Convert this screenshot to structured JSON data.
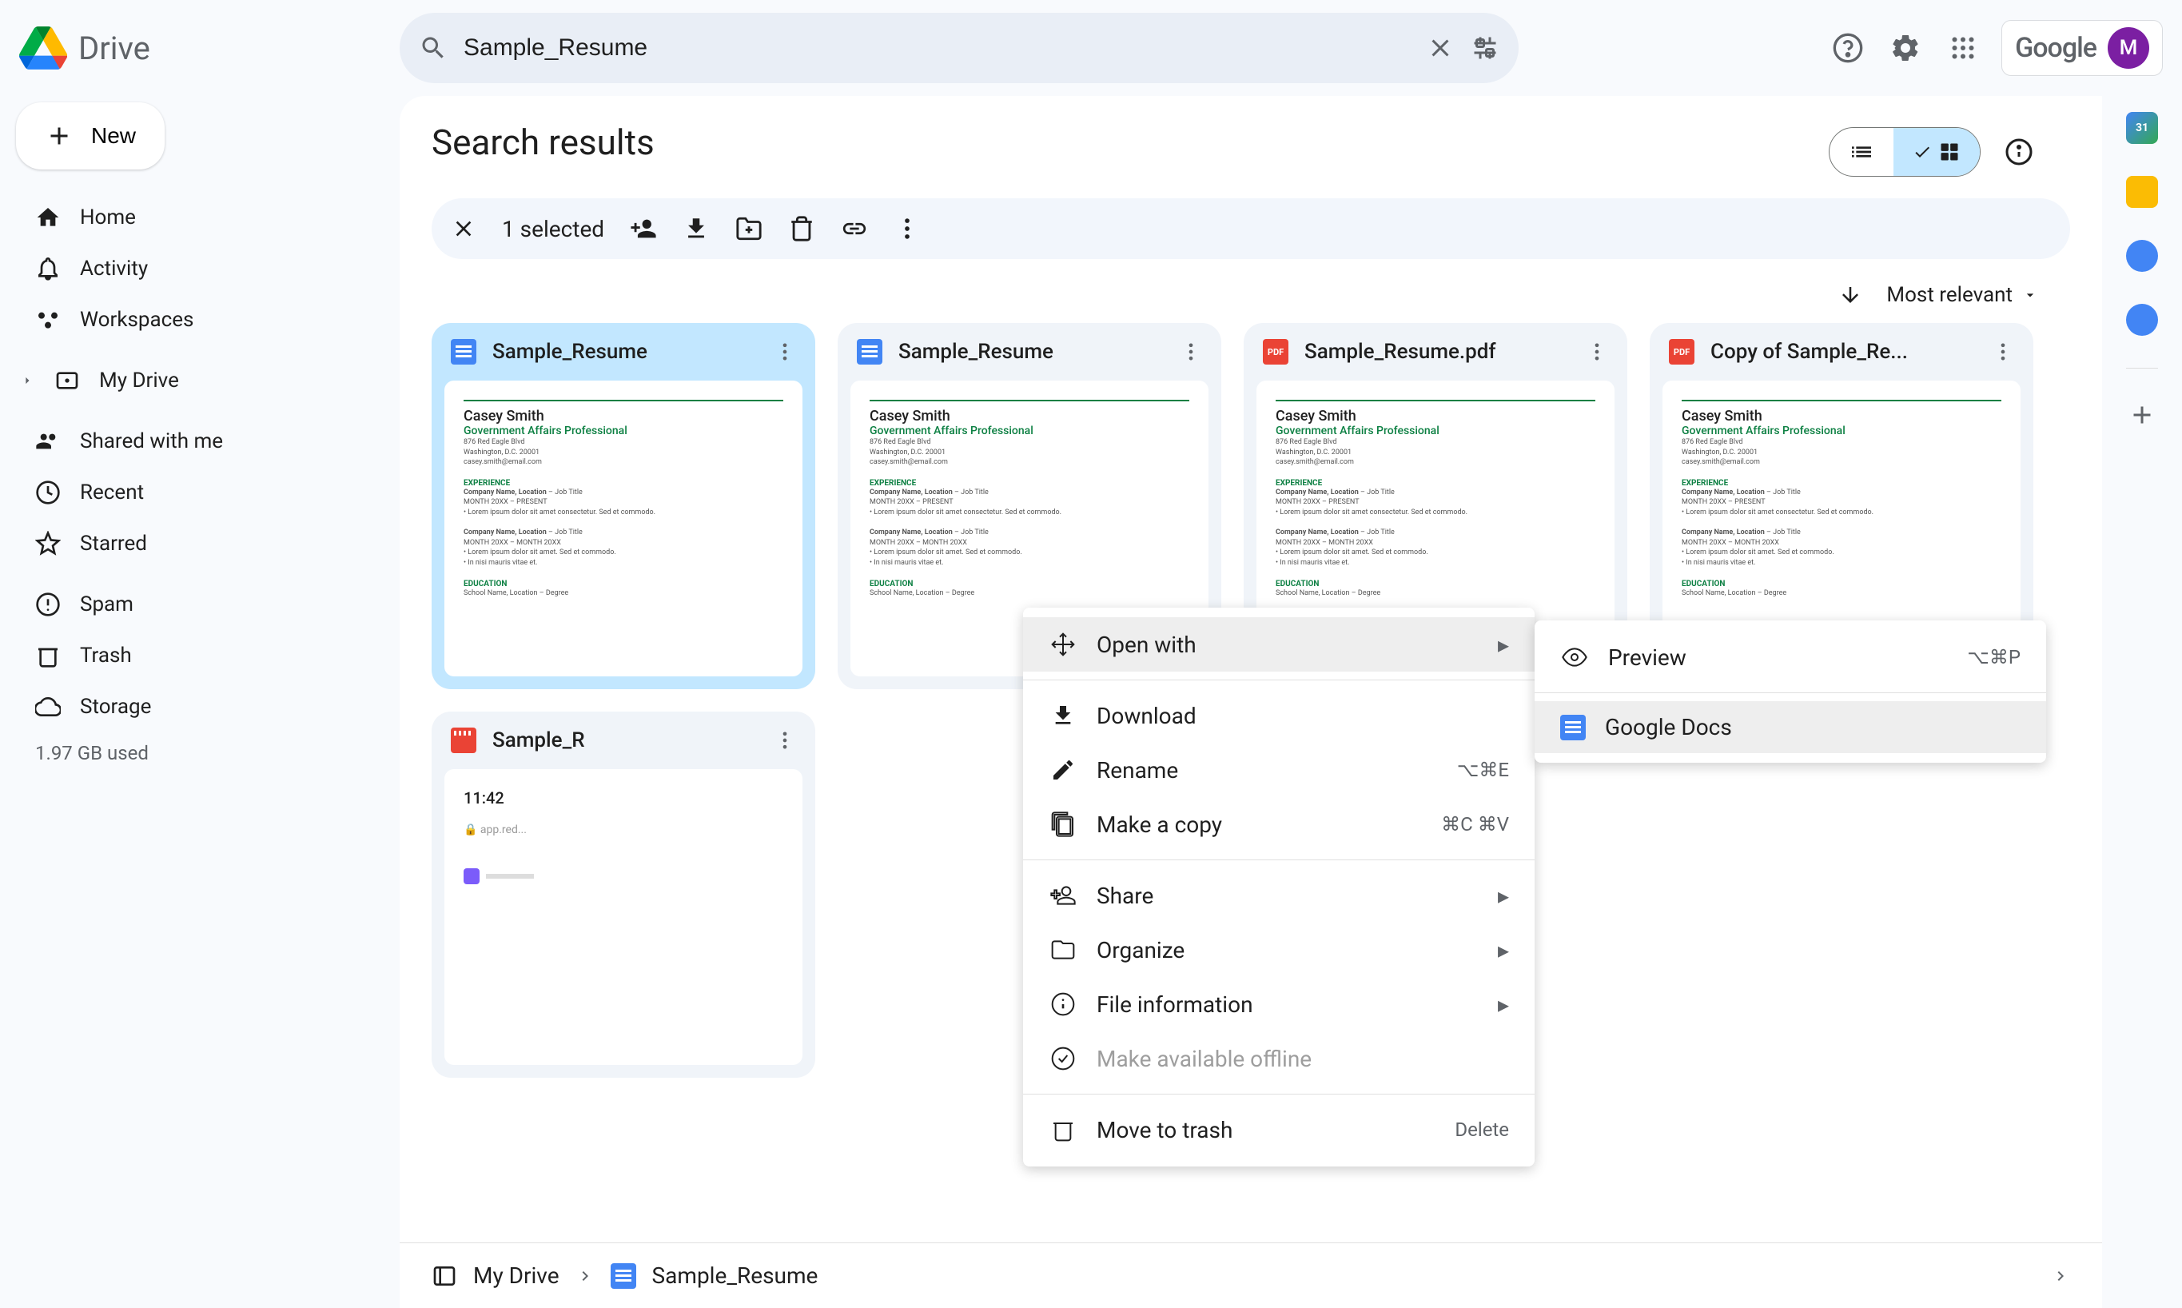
{
  "header": {
    "app_name": "Drive",
    "search_value": "Sample_Resume",
    "google_label": "Google",
    "avatar_initial": "M"
  },
  "sidebar": {
    "new_label": "New",
    "items": [
      {
        "label": "Home",
        "icon": "home"
      },
      {
        "label": "Activity",
        "icon": "bell"
      },
      {
        "label": "Workspaces",
        "icon": "workspaces"
      },
      {
        "label": "My Drive",
        "icon": "drive",
        "caret": true
      },
      {
        "label": "Shared with me",
        "icon": "people"
      },
      {
        "label": "Recent",
        "icon": "clock"
      },
      {
        "label": "Starred",
        "icon": "star"
      },
      {
        "label": "Spam",
        "icon": "spam"
      },
      {
        "label": "Trash",
        "icon": "trash"
      },
      {
        "label": "Storage",
        "icon": "cloud"
      }
    ],
    "storage_used": "1.97 GB used"
  },
  "main": {
    "title": "Search results",
    "selection_count": "1 selected",
    "sort_label": "Most relevant",
    "files": [
      {
        "name": "Sample_Resume",
        "type": "docs",
        "selected": true
      },
      {
        "name": "Sample_Resume",
        "type": "docs"
      },
      {
        "name": "Sample_Resume.pdf",
        "type": "pdf"
      },
      {
        "name": "Copy of Sample_Re...",
        "type": "pdf"
      },
      {
        "name": "Sample_R",
        "type": "video"
      },
      {
        "name": "",
        "type": "docs_hidden"
      }
    ],
    "resume_preview": {
      "name": "Casey Smith",
      "title": "Government Affairs Professional",
      "experience_label": "EXPERIENCE",
      "education_label": "EDUCATION"
    }
  },
  "context_menu": {
    "items": [
      {
        "label": "Open with",
        "icon": "open",
        "submenu": true,
        "hover": true
      },
      {
        "divider": true
      },
      {
        "label": "Download",
        "icon": "download"
      },
      {
        "label": "Rename",
        "icon": "rename",
        "shortcut": "⌥⌘E"
      },
      {
        "label": "Make a copy",
        "icon": "copy",
        "shortcut": "⌘C ⌘V"
      },
      {
        "divider": true
      },
      {
        "label": "Share",
        "icon": "share",
        "submenu": true
      },
      {
        "label": "Organize",
        "icon": "organize",
        "submenu": true
      },
      {
        "label": "File information",
        "icon": "info",
        "submenu": true
      },
      {
        "label": "Make available offline",
        "icon": "offline",
        "disabled": true
      },
      {
        "divider": true
      },
      {
        "label": "Move to trash",
        "icon": "trash",
        "shortcut": "Delete"
      }
    ]
  },
  "submenu": {
    "items": [
      {
        "label": "Preview",
        "icon": "eye",
        "shortcut": "⌥⌘P"
      },
      {
        "divider": true
      },
      {
        "label": "Google Docs",
        "icon": "docs",
        "hover": true
      }
    ]
  },
  "footer": {
    "crumb1": "My Drive",
    "crumb2": "Sample_Resume"
  }
}
